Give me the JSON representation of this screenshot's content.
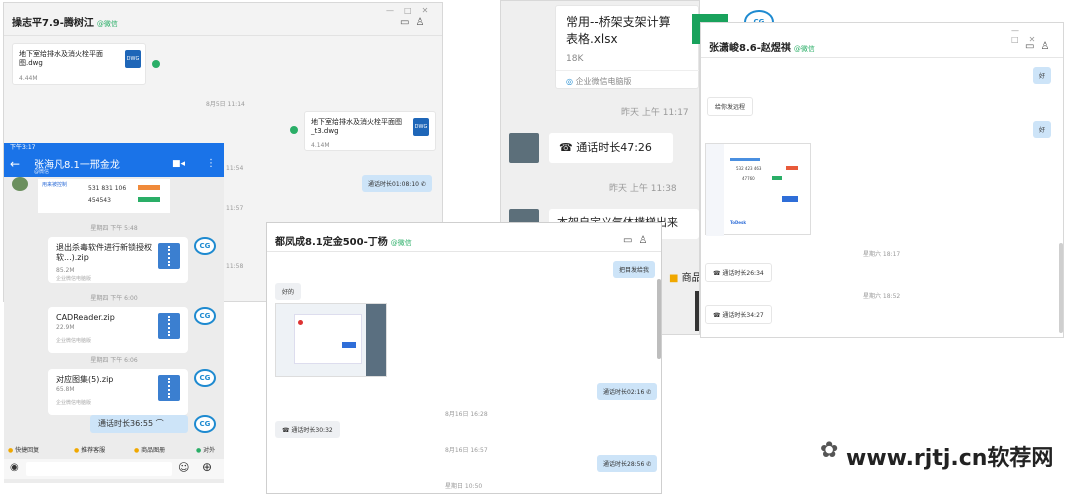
{
  "w1": {
    "title": "操志平7.9-腾树江",
    "tag": "@微信",
    "file1": {
      "name": "地下室给排水及消火栓平面图.dwg",
      "size": "4.44M"
    },
    "file2": {
      "name": "地下室给排水及消火栓平面图_t3.dwg",
      "size": "4.14M"
    },
    "times": [
      "8月5日 11:14",
      "11:54",
      "11:57",
      "11:58"
    ],
    "call": "通话时长01:08:10",
    "call_prefix": "",
    "dwg_icon": "DWG"
  },
  "w2": {
    "file": {
      "name": "常用--桥架支架计算表格.xlsx",
      "size": "18K",
      "source": "企业微信电脑版"
    },
    "time1": "昨天 上午 11:17",
    "call": "通话时长47:26",
    "time2": "昨天 上午 11:38",
    "partial": "本架自定义气体横梯出来",
    "shop_partial": "商品"
  },
  "w3": {
    "title": "张潇峻8.6-赵煜祺",
    "tag": "@微信",
    "msg1": "好",
    "msg2": "给你发远程",
    "msg3": "好",
    "remote": {
      "id": "532 423 463",
      "pwd": "47760",
      "brand": "ToDesk"
    },
    "time1": "星期六 18:17",
    "call1": "通话时长26:34",
    "time2": "星期六 18:52",
    "call2": "通话时长34:27"
  },
  "w4": {
    "status_time": "下午3:17",
    "title": "张海凡8.1一邢金龙",
    "subtitle": "@微信",
    "remote_row": {
      "label": "用来被控制",
      "id": "531 831 106",
      "code": "454543"
    },
    "times": [
      "星期四 下午 5:48",
      "星期四 下午 6:00",
      "星期四 下午 6:06"
    ],
    "files": [
      {
        "name": "退出杀毒软件进行新锁授权软...).zip",
        "size": "85.2M",
        "source": "企业微信电脑版"
      },
      {
        "name": "CADReader.zip",
        "size": "22.9M",
        "source": "企业微信电脑版"
      },
      {
        "name": "对应图集(5).zip",
        "size": "65.8M",
        "source": "企业微信电脑版"
      }
    ],
    "call": "通话时长36:55",
    "bottom": [
      "快捷回复",
      "推荐客服",
      "商品图册",
      "对外"
    ],
    "cg": "CG"
  },
  "w5": {
    "title": "都凤成8.1定金500-丁杨",
    "tag": "@微信",
    "msg_sent": "把目发给我",
    "msg_recv": "好的",
    "call1": "通话时长02:16",
    "time1": "8月16日 16:28",
    "call2": "通话时长30:32",
    "time2": "8月16日 16:57",
    "call3": "通话时长28:56",
    "time3": "星期日 10:50"
  },
  "brand": {
    "site": "www.rjtj.cn软荐网"
  },
  "colors": {
    "accent": "#1e66b8",
    "green": "#2aae67",
    "bubble": "#cde4f8",
    "phone_bar": "#1a73e8"
  }
}
